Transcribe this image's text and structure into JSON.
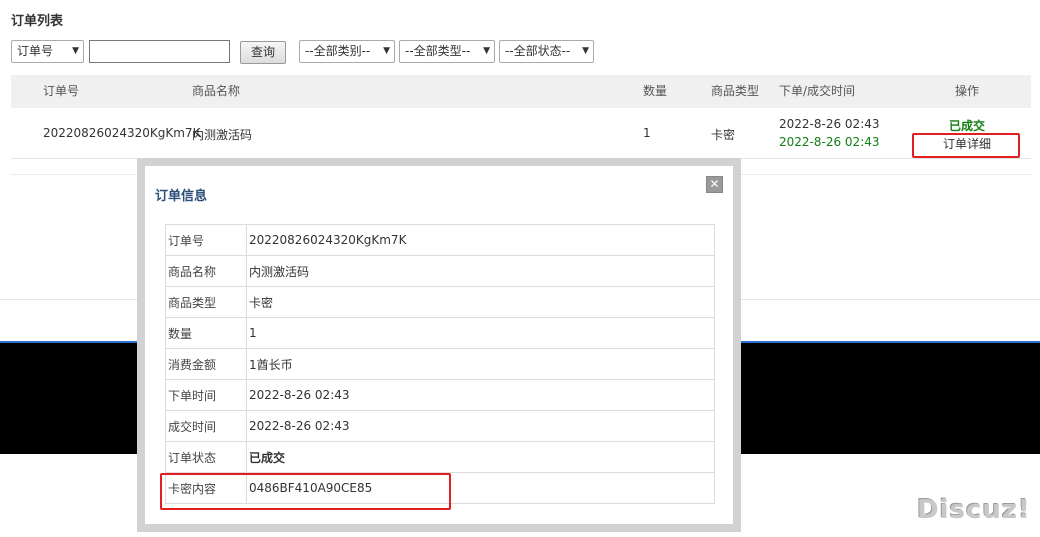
{
  "page": {
    "title": "订单列表"
  },
  "filters": {
    "field_select": "订单号",
    "search_value": "",
    "query_button": "查询",
    "category_select": "--全部类别--",
    "type_select": "--全部类型--",
    "status_select": "--全部状态--"
  },
  "table": {
    "headers": {
      "order_no": "订单号",
      "product_name": "商品名称",
      "quantity": "数量",
      "product_type": "商品类型",
      "time": "下单/成交时间",
      "action": "操作"
    },
    "rows": [
      {
        "order_no": "20220826024320KgKm7K",
        "product_name": "内测激活码",
        "quantity": "1",
        "product_type": "卡密",
        "order_time": "2022-8-26 02:43",
        "complete_time": "2022-8-26 02:43",
        "status": "已成交",
        "detail_link": "订单详细"
      }
    ]
  },
  "modal": {
    "title": "订单信息",
    "close_icon": "close-icon",
    "fields": [
      {
        "label": "订单号",
        "value": "20220826024320KgKm7K"
      },
      {
        "label": "商品名称",
        "value": "内测激活码"
      },
      {
        "label": "商品类型",
        "value": "卡密"
      },
      {
        "label": "数量",
        "value": "1"
      },
      {
        "label": "消费金额",
        "value": "1酋长币"
      },
      {
        "label": "下单时间",
        "value": "2022-8-26 02:43"
      },
      {
        "label": "成交时间",
        "value": "2022-8-26 02:43"
      },
      {
        "label": "订单状态",
        "value": "已成交"
      },
      {
        "label": "卡密内容",
        "value": "0486BF410A90CE85"
      }
    ]
  },
  "watermark": "Discuz!",
  "colors": {
    "success_green": "#128012",
    "highlight_red": "#e02020",
    "title_blue": "#2b4e7a"
  }
}
